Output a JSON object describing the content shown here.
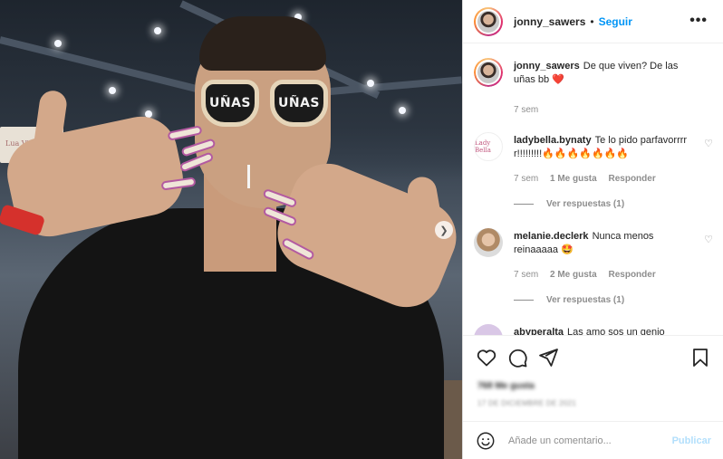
{
  "photo": {
    "glasses_text_left": "UÑAS",
    "glasses_text_right": "UÑAS",
    "booth_text": "Lua Vieira"
  },
  "post_header": {
    "username": "jonny_sawers",
    "separator": "•",
    "follow_label": "Seguir",
    "more_label": "•••"
  },
  "caption": {
    "username": "jonny_sawers",
    "text": "De que viven? De las uñas bb ❤️",
    "time": "7 sem"
  },
  "comments": [
    {
      "username": "ladybella.bynaty",
      "text": "Te lo pido parfavorrrrr!!!!!!!!!🔥🔥🔥🔥🔥🔥🔥",
      "time": "7 sem",
      "likes": "1 Me gusta",
      "reply": "Responder",
      "view_replies": "Ver respuestas (1)"
    },
    {
      "username": "melanie.declerk",
      "text": "Nunca menos reinaaaaa 🤩",
      "time": "7 sem",
      "likes": "2 Me gusta",
      "reply": "Responder",
      "view_replies": "Ver respuestas (1)"
    },
    {
      "username": "abyperalta",
      "text": "Las amo sos un genio"
    }
  ],
  "engagement": {
    "likes": "768 Me gusta",
    "date": "17 DE DICIEMBRE DE 2021"
  },
  "add_comment": {
    "placeholder": "Añade un comentario...",
    "post_label": "Publicar"
  },
  "colors": {
    "link": "#0095f6",
    "post_disabled": "#b2dffc",
    "heart": "#ed4956"
  }
}
